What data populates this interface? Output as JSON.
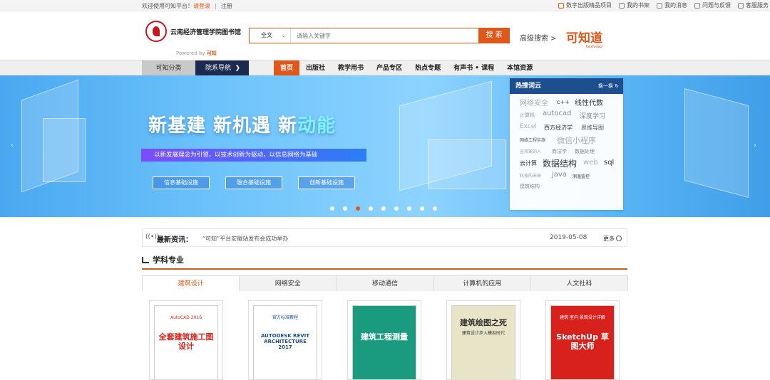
{
  "topbar": {
    "welcome": "欢迎使用可知平台！",
    "login": "请登录",
    "register": "注册",
    "links": [
      {
        "label": "数字出版精品项目",
        "icon": "book-icon",
        "highlight": true
      },
      {
        "label": "我的书架",
        "icon": "bookshelf-icon",
        "highlight": false
      },
      {
        "label": "我的消息",
        "icon": "message-icon",
        "highlight": false
      },
      {
        "label": "问题与反馈",
        "icon": "mail-icon",
        "highlight": false
      },
      {
        "label": "客服服务",
        "icon": "phone-icon",
        "highlight": false
      }
    ]
  },
  "header": {
    "library_name": "云南经济管理学院图书馆",
    "powered_by": "Powered by",
    "powered_brand": "可知",
    "search_scope": "全文",
    "search_placeholder": "请输入关键字",
    "search_button": "搜 索",
    "advanced_search": "高级搜索 >",
    "brand_text": "可知",
    "brand_char": "道",
    "brand_sub": "Kezhidao"
  },
  "nav": {
    "category": "可知分类",
    "department": "院系导航",
    "department_arrow": "❯",
    "items": [
      {
        "label": "首页",
        "active": true
      },
      {
        "label": "出版社",
        "active": false
      },
      {
        "label": "教学用书",
        "active": false
      },
      {
        "label": "产品专区",
        "active": false
      },
      {
        "label": "热点专题",
        "active": false
      },
      {
        "label": "有声书 • 课程",
        "active": false
      },
      {
        "label": "本馆资源",
        "active": false
      }
    ]
  },
  "banner": {
    "headline_parts": [
      "新基建 新机遇 新",
      "动能"
    ],
    "slogan": "以新发展理念为引领，以技术创新为驱动，以信息网络为基础",
    "pills": [
      "信息基础设施",
      "融合基础设施",
      "创新基础设施"
    ],
    "slide_count": 9,
    "active_slide": 3
  },
  "hot_words": {
    "title": "热搜词云",
    "refresh": "换一换",
    "words": [
      {
        "text": "网络安全",
        "size": 10,
        "color": "#aaa"
      },
      {
        "text": "c++",
        "size": 8,
        "color": "#333"
      },
      {
        "text": "线性代数",
        "size": 10,
        "color": "#333"
      },
      {
        "text": "计算机",
        "size": 7,
        "color": "#999"
      },
      {
        "text": "autocad",
        "size": 10,
        "color": "#888"
      },
      {
        "text": "深度学习",
        "size": 9,
        "color": "#888"
      },
      {
        "text": "Excel",
        "size": 9,
        "color": "#aaa"
      },
      {
        "text": "西方经济学",
        "size": 8,
        "color": "#333"
      },
      {
        "text": "思维导图",
        "size": 8,
        "color": "#555"
      },
      {
        "text": "网络工程实施",
        "size": 6,
        "color": "#555"
      },
      {
        "text": "微信小程序",
        "size": 11,
        "color": "#aaa"
      },
      {
        "text": "吉风家的人",
        "size": 6,
        "color": "#999"
      },
      {
        "text": "商法学",
        "size": 7,
        "color": "#888"
      },
      {
        "text": "数据处理",
        "size": 7,
        "color": "#888"
      },
      {
        "text": "云计算",
        "size": 8,
        "color": "#333"
      },
      {
        "text": "数据结构",
        "size": 12,
        "color": "#333"
      },
      {
        "text": "web",
        "size": 10,
        "color": "#aaa"
      },
      {
        "text": "sql",
        "size": 10,
        "color": "#333"
      },
      {
        "text": "科技的未来",
        "size": 6,
        "color": "#999"
      },
      {
        "text": "java",
        "size": 10,
        "color": "#888"
      },
      {
        "text": "测温监控",
        "size": 6,
        "color": "#333"
      },
      {
        "text": "建筑结构",
        "size": 7,
        "color": "#888"
      }
    ]
  },
  "news": {
    "label": "最新资讯：",
    "message": "“可知”平台安徽站发布会成功举办",
    "date": "2019-05-08",
    "more": "更多"
  },
  "subjects": {
    "title": "学科专业",
    "tabs": [
      {
        "label": "建筑设计",
        "active": true
      },
      {
        "label": "网络安全",
        "active": false
      },
      {
        "label": "移动通信",
        "active": false
      },
      {
        "label": "计算机的应用",
        "active": false
      },
      {
        "label": "人文社科",
        "active": false
      }
    ],
    "books": [
      {
        "title": "全套建筑施工图设计",
        "sub": "AutoCAD 2016",
        "bg": "#ffffff",
        "fg": "#d9261c"
      },
      {
        "title": "AUTODESK REVIT ARCHITECTURE 2017",
        "sub": "官方标准教程",
        "bg": "#ffffff",
        "fg": "#1a4e8a"
      },
      {
        "title": "建筑工程测量",
        "sub": "",
        "bg": "#1a9a7e",
        "fg": "#ffffff"
      },
      {
        "title": "建筑绘图之死",
        "sub": "建筑设计步入模拟时代",
        "bg": "#e8e4c8",
        "fg": "#333333"
      },
      {
        "title": "SketchUp 草图大师",
        "sub": "建筑·室内·景观设计详解",
        "bg": "#d8211c",
        "fg": "#ffffff"
      }
    ]
  }
}
